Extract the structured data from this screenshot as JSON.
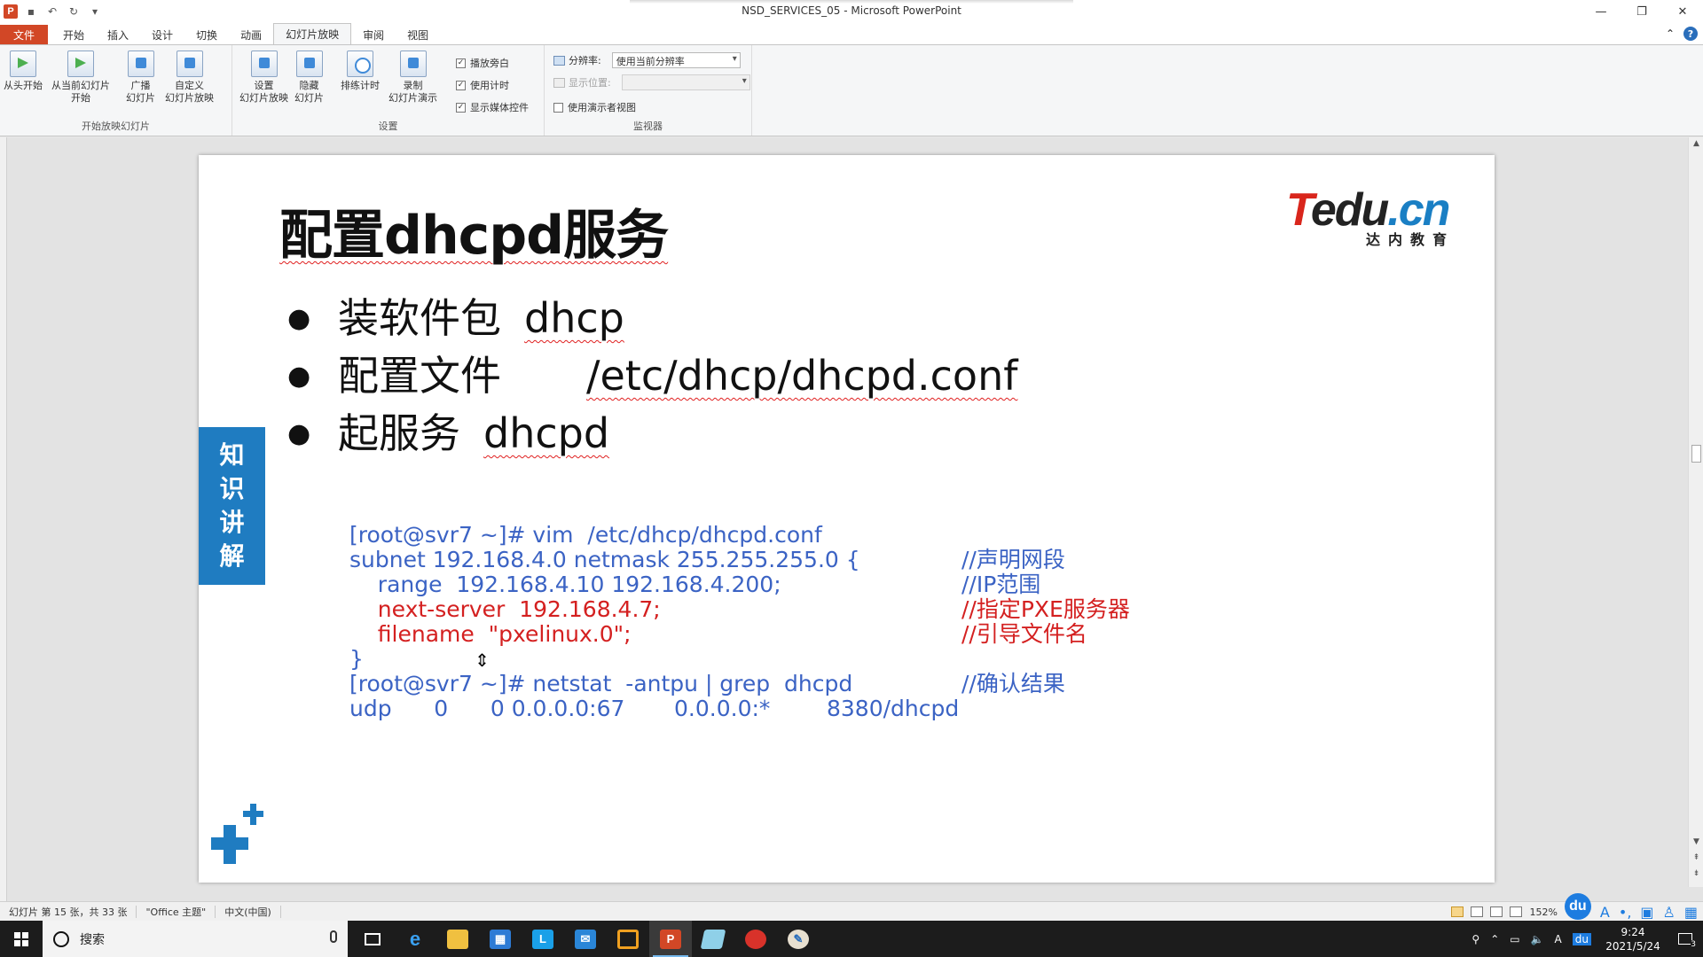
{
  "window": {
    "title": "NSD_SERVICES_05 - Microsoft PowerPoint"
  },
  "quick_access": {
    "logo": "P"
  },
  "tabs": [
    {
      "label": "文件"
    },
    {
      "label": "开始"
    },
    {
      "label": "插入"
    },
    {
      "label": "设计"
    },
    {
      "label": "切换"
    },
    {
      "label": "动画"
    },
    {
      "label": "幻灯片放映"
    },
    {
      "label": "审阅"
    },
    {
      "label": "视图"
    }
  ],
  "ribbon": {
    "groups": {
      "start": {
        "label": "开始放映幻灯片",
        "from_start": "从头开始",
        "from_current_1": "从当前幻灯片",
        "from_current_2": "开始",
        "broadcast_1": "广播",
        "broadcast_2": "幻灯片",
        "custom_1": "自定义",
        "custom_2": "幻灯片放映"
      },
      "setup": {
        "label": "设置",
        "setup_1": "设置",
        "setup_2": "幻灯片放映",
        "hide_1": "隐藏",
        "hide_2": "幻灯片",
        "rehearse": "排练计时",
        "record_1": "录制",
        "record_2": "幻灯片演示",
        "play_narration": "播放旁白",
        "use_timings": "使用计时",
        "show_media": "显示媒体控件"
      },
      "monitors": {
        "label": "监视器",
        "resolution_label": "分辨率:",
        "resolution_value": "使用当前分辨率",
        "show_on_label": "显示位置:",
        "presenter_view": "使用演示者视图"
      }
    }
  },
  "slide": {
    "title": "配置dhcpd服务",
    "logo": {
      "brand_t": "T",
      "brand_mid": "edu",
      "brand_cn": ".cn",
      "sub": "达内教育"
    },
    "bullets": [
      {
        "text": "装软件包",
        "code": "dhcp"
      },
      {
        "text": "配置文件",
        "code": "/etc/dhcp/dhcpd.conf"
      },
      {
        "text": "起服务",
        "code": "dhcpd"
      }
    ],
    "side_tag": [
      "知",
      "识",
      "讲",
      "解"
    ],
    "code_lines": [
      "[root@svr7 ~]# vim  /etc/dhcp/dhcpd.conf",
      "subnet 192.168.4.0 netmask 255.255.255.0 {",
      "    range  192.168.4.10 192.168.4.200;",
      "    next-server  192.168.4.7;",
      "    filename  \"pxelinux.0\";",
      "}",
      "[root@svr7 ~]# netstat  -antpu | grep  dhcpd",
      "udp      0      0 0.0.0.0:67       0.0.0.0:*        8380/dhcpd"
    ],
    "comments": [
      "//声明网段",
      "//IP范围",
      "//指定PXE服务器",
      "//引导文件名",
      "//确认结果"
    ]
  },
  "status": {
    "slide_info": "幻灯片 第 15 张，共 33 张",
    "theme": "\"Office 主题\"",
    "language": "中文(中国)",
    "zoom": "152%"
  },
  "ime": {
    "badge": "du",
    "mode": "A"
  },
  "taskbar": {
    "search_placeholder": "搜索",
    "time": "9:24",
    "date": "2021/5/24",
    "notifications": "3",
    "tray_ime": "A",
    "tray_du": "du"
  },
  "colors": {
    "accent_orange": "#d24726",
    "side_tag_blue": "#1f7cc1",
    "code_blue": "#3b63c4",
    "code_red": "#d42020"
  }
}
